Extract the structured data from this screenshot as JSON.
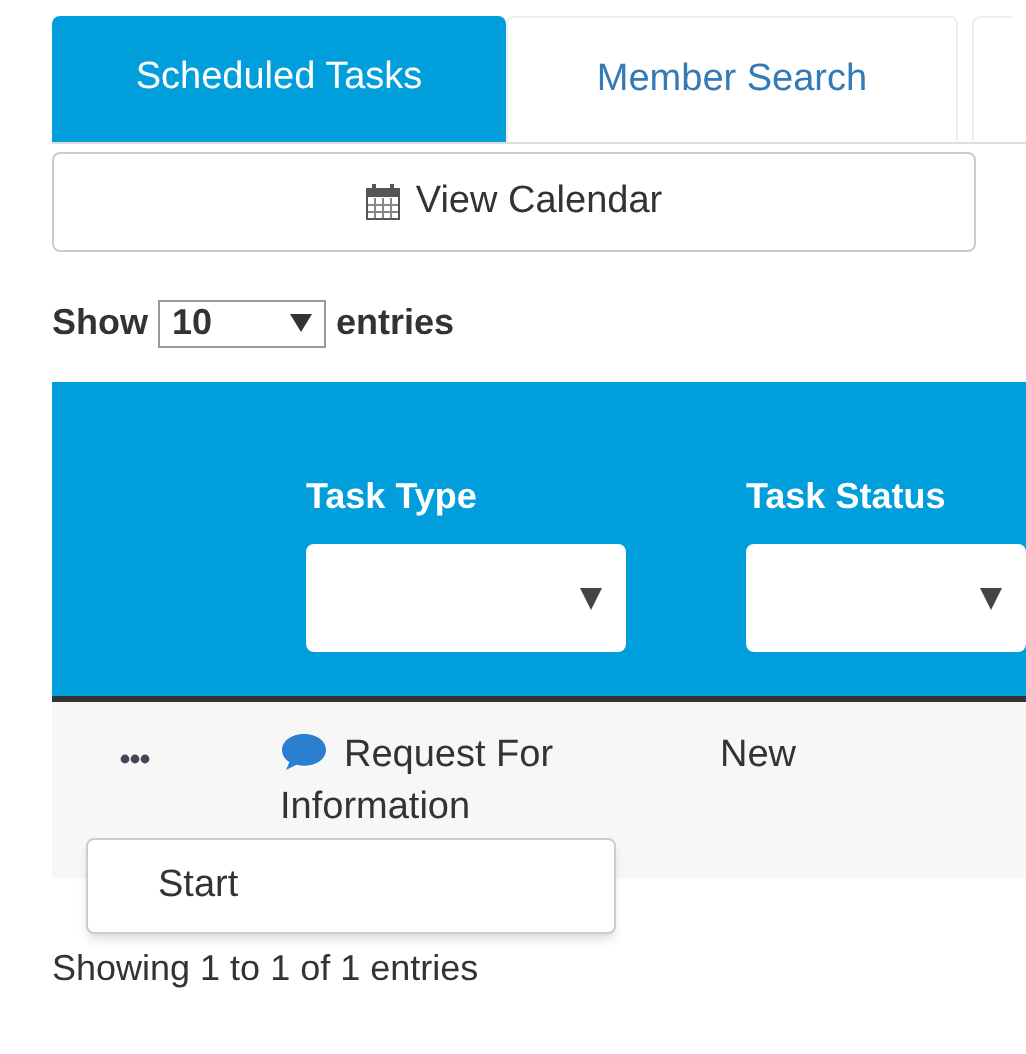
{
  "tabs": [
    {
      "label": "Scheduled Tasks",
      "selected": true
    },
    {
      "label": "Member Search",
      "selected": false
    }
  ],
  "view_calendar_button": {
    "label": "View Calendar"
  },
  "length_control": {
    "prefix": "Show",
    "value": "10",
    "suffix": "entries"
  },
  "table": {
    "columns": [
      {
        "label": "Task Type"
      },
      {
        "label": "Task Status"
      }
    ],
    "rows": [
      {
        "task_type": "Request For Information",
        "task_status": "New"
      }
    ]
  },
  "action_menu": {
    "items": [
      {
        "label": "Start"
      }
    ]
  },
  "info": "Showing 1 to 1 of 1 entries"
}
